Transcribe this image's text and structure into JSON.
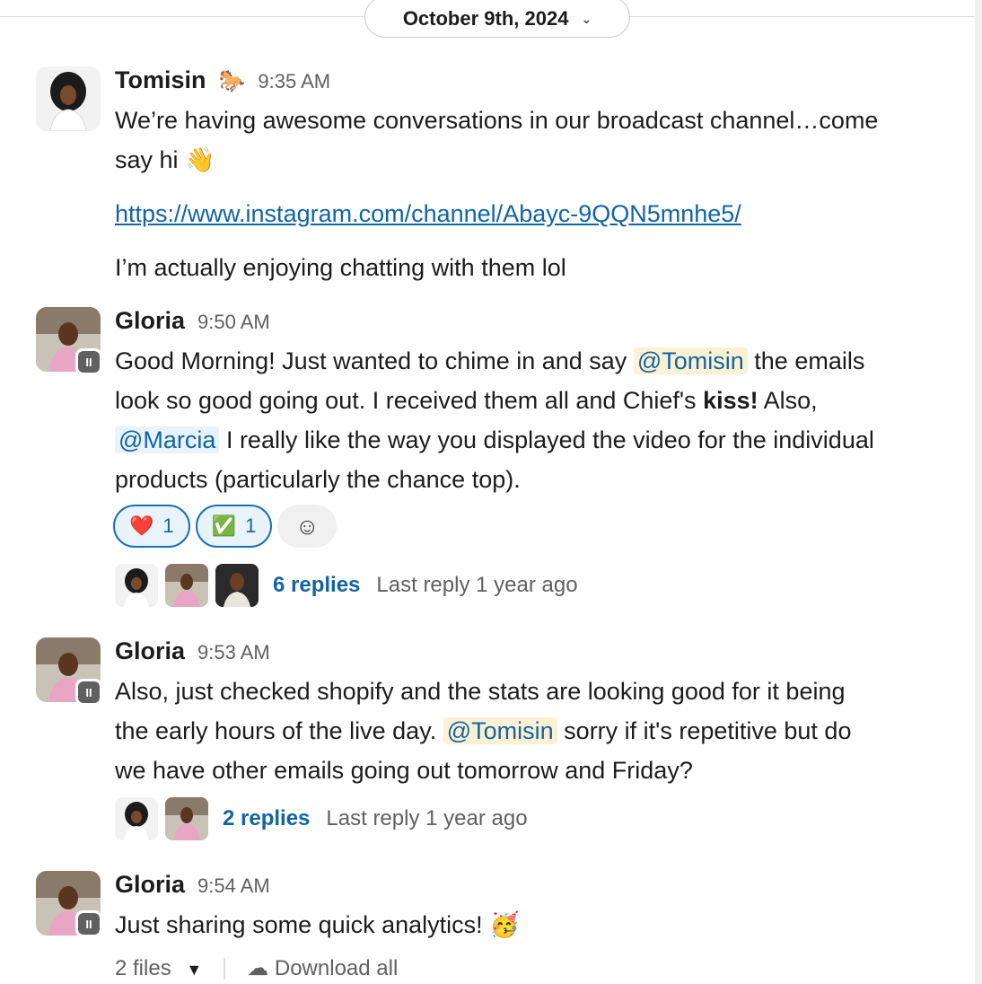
{
  "date_divider": {
    "label": "October 9th, 2024"
  },
  "messages": [
    {
      "author": "Tomisin",
      "author_emoji": "🐎",
      "time": "9:35 AM",
      "line1": "We’re having awesome conversations in our broadcast channel…come",
      "line2": "say hi",
      "line2_emoji": "👋",
      "link": "https://www.instagram.com/channel/Abayc-9QQN5mnhe5/",
      "line3": "I’m actually enjoying chatting with them lol"
    },
    {
      "author": "Gloria",
      "time": "9:50 AM",
      "p1": "Good Morning! Just wanted to chime in and say",
      "mention1": "@Tomisin",
      "p2": "the emails",
      "p3": "look so good going out. I received them all and Chief's",
      "bold": "kiss!",
      "p4": "Also,",
      "mention2": "@Marcia",
      "p5": "I really like the way you displayed the video for the individual",
      "p6": "products (particularly the chance top).",
      "reactions": [
        {
          "emoji": "❤️",
          "count": "1"
        },
        {
          "emoji": "✅",
          "count": "1"
        }
      ],
      "replies": "6 replies",
      "last_reply": "Last reply 1 year ago"
    },
    {
      "author": "Gloria",
      "time": "9:53 AM",
      "p1": "Also, just checked shopify and the stats are looking good for it being",
      "p2": "the early hours of the live day.",
      "mention": "@Tomisin",
      "p3": "sorry if it's repetitive but do",
      "p4": "we have other emails going out tomorrow and Friday?",
      "replies": "2 replies",
      "last_reply": "Last reply 1 year ago"
    },
    {
      "author": "Gloria",
      "time": "9:54 AM",
      "text": "Just sharing some quick analytics!",
      "emoji": "🥳",
      "files": "2 files",
      "download": "Download all"
    }
  ],
  "colors": {
    "link": "#1264a3",
    "mention_bg": "#fdf1d4",
    "reaction_border": "#1d6fb8"
  }
}
